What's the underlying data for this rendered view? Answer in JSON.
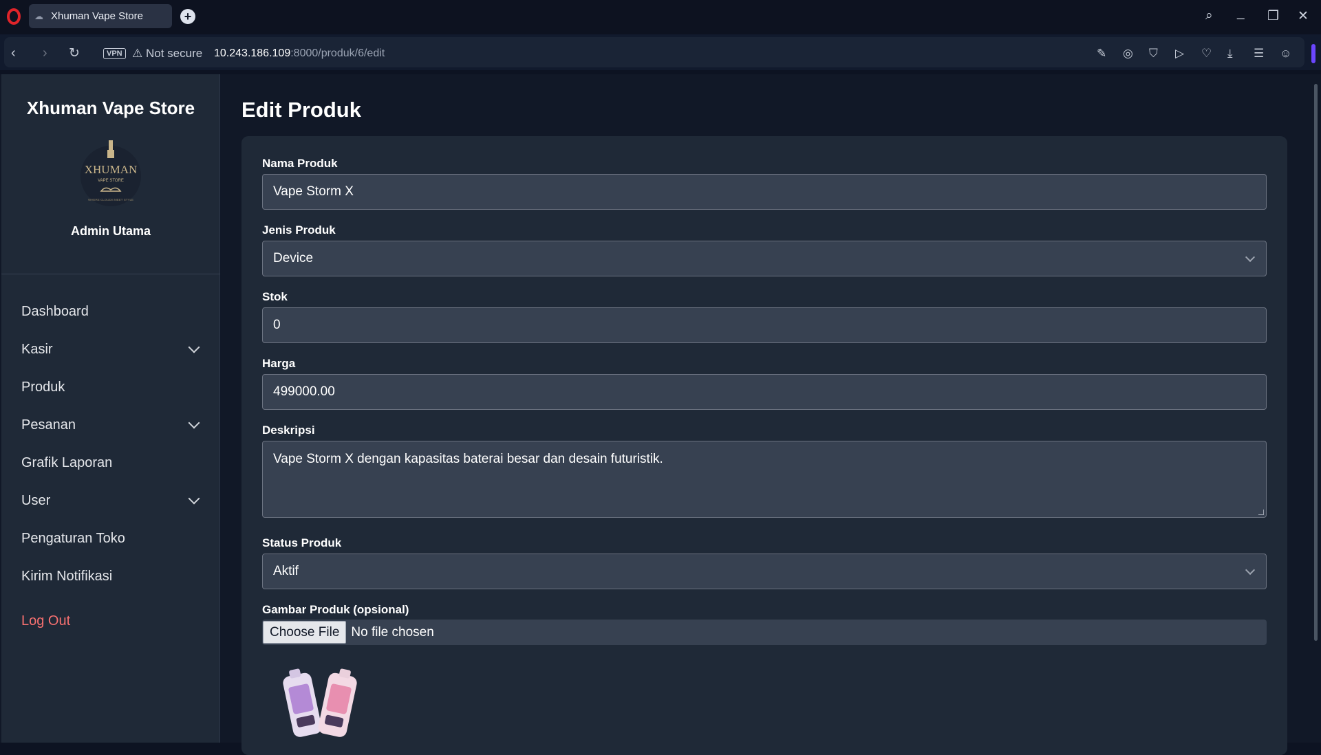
{
  "browser": {
    "tab_title": "Xhuman Vape Store",
    "new_tab": "+",
    "vpn_badge": "VPN",
    "security_text": "Not secure",
    "url_host": "10.243.186.109",
    "url_path": ":8000/produk/6/edit"
  },
  "sidebar": {
    "store_name": "Xhuman Vape Store",
    "logo_text": "XHUMAN",
    "logo_subtext": "VAPE STORE",
    "logo_slogan": "WHERE CLOUDS MEET STYLE",
    "admin_name": "Admin Utama",
    "menu": [
      {
        "label": "Dashboard",
        "has_submenu": false
      },
      {
        "label": "Kasir",
        "has_submenu": true
      },
      {
        "label": "Produk",
        "has_submenu": false
      },
      {
        "label": "Pesanan",
        "has_submenu": true
      },
      {
        "label": "Grafik Laporan",
        "has_submenu": false
      },
      {
        "label": "User",
        "has_submenu": true
      },
      {
        "label": "Pengaturan Toko",
        "has_submenu": false
      },
      {
        "label": "Kirim Notifikasi",
        "has_submenu": false
      }
    ],
    "logout_label": "Log Out"
  },
  "page": {
    "title": "Edit Produk",
    "form": {
      "nama_label": "Nama Produk",
      "nama_value": "Vape Storm X",
      "jenis_label": "Jenis Produk",
      "jenis_value": "Device",
      "stok_label": "Stok",
      "stok_value": "0",
      "harga_label": "Harga",
      "harga_value": "499000.00",
      "deskripsi_label": "Deskripsi",
      "deskripsi_value": "Vape Storm X dengan kapasitas baterai besar dan desain futuristik.",
      "status_label": "Status Produk",
      "status_value": "Aktif",
      "gambar_label": "Gambar Produk (opsional)",
      "choose_file_label": "Choose File",
      "no_file_text": "No file chosen"
    }
  },
  "colors": {
    "background": "#111827",
    "panel": "#1f2937",
    "input": "#374151",
    "logout": "#f87171"
  }
}
